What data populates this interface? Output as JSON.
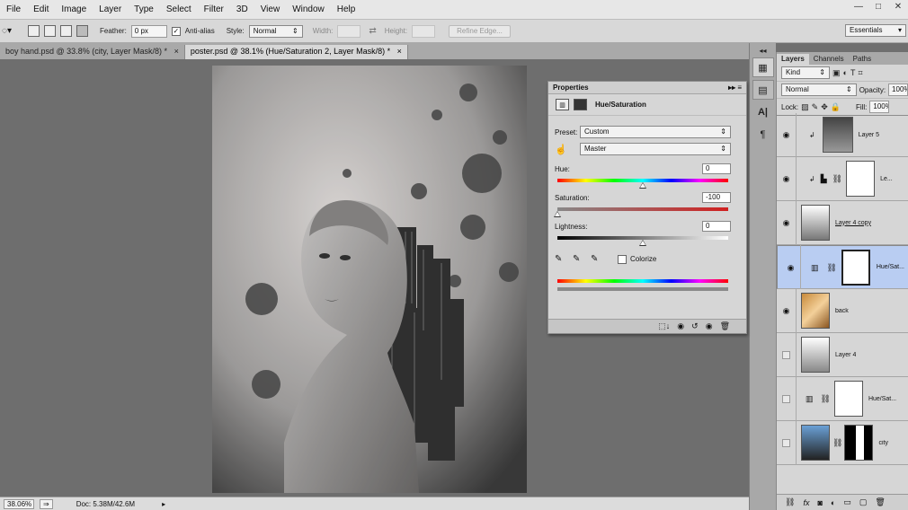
{
  "menu": [
    "File",
    "Edit",
    "Image",
    "Layer",
    "Type",
    "Select",
    "Filter",
    "3D",
    "View",
    "Window",
    "Help"
  ],
  "window_buttons": {
    "minimize": "—",
    "maximize": "□",
    "close": "✕"
  },
  "options": {
    "feather_label": "Feather:",
    "feather_value": "0 px",
    "antialias_label": "Anti-alias",
    "antialias_check": "✓",
    "style_label": "Style:",
    "style_value": "Normal",
    "width_label": "Width:",
    "height_label": "Height:",
    "refine_label": "Refine Edge...",
    "workspace": "Essentials"
  },
  "tabs": [
    {
      "label": "boy hand.psd @ 33.8% (city, Layer Mask/8) *",
      "close": "×"
    },
    {
      "label": "poster.psd @ 38.1% (Hue/Saturation 2, Layer Mask/8) *",
      "close": "×"
    }
  ],
  "status": {
    "zoom": "38.06%",
    "doc": "Doc: 5.38M/42.6M"
  },
  "properties": {
    "title": "Properties",
    "panel_name": "Hue/Saturation",
    "preset_label": "Preset:",
    "preset_value": "Custom",
    "channel_value": "Master",
    "hue_label": "Hue:",
    "hue_value": "0",
    "sat_label": "Saturation:",
    "sat_value": "-100",
    "light_label": "Lightness:",
    "light_value": "0",
    "colorize_label": "Colorize"
  },
  "slider_levels": {
    "hue": 0.5,
    "saturation": 0.0,
    "lightness": 0.5
  },
  "layers_panel": {
    "tabs": [
      "Layers",
      "Channels",
      "Paths"
    ],
    "kind_label": "Kind",
    "blend_mode": "Normal",
    "opacity_label": "Opacity:",
    "opacity_value": "100%",
    "lock_label": "Lock:",
    "fill_label": "Fill:",
    "fill_value": "100%",
    "layers": [
      {
        "name": "Layer 5",
        "visible": true,
        "underline": false,
        "selected": false
      },
      {
        "name": "Le...",
        "visible": true,
        "underline": false,
        "selected": false
      },
      {
        "name": "Layer 4 copy",
        "visible": true,
        "underline": true,
        "selected": false
      },
      {
        "name": "Hue/Sat...",
        "visible": true,
        "underline": false,
        "selected": true
      },
      {
        "name": "back",
        "visible": true,
        "underline": false,
        "selected": false
      },
      {
        "name": "Layer 4",
        "visible": false,
        "underline": false,
        "selected": false
      },
      {
        "name": "Hue/Sat...",
        "visible": false,
        "underline": false,
        "selected": false
      },
      {
        "name": "city",
        "visible": false,
        "underline": false,
        "selected": false
      }
    ]
  },
  "colors": {
    "selection": "#b9cdf2",
    "panel": "#d6d6d6",
    "workspace": "#6e6e6e"
  }
}
